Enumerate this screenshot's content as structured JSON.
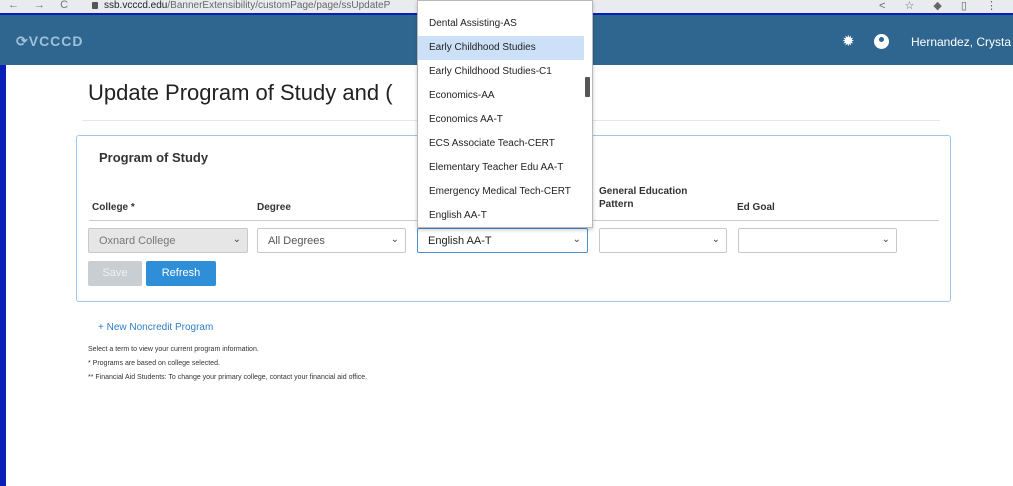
{
  "browser": {
    "nav_icons": "← → C",
    "url_host": "ssb.vcccd.edu",
    "url_path": "/BannerExtensibility/customPage/page/ssUpdateP",
    "tools": "< ☆ ◆ ▯ ⋮"
  },
  "header": {
    "logo": "VCCCD",
    "user_name": "Hernandez, Crysta"
  },
  "page": {
    "title": "Update Program of Study and",
    "title_overflow": "(",
    "card_title": "Program of Study"
  },
  "columns": {
    "college": "College *",
    "degree": "Degree",
    "ge_pattern_line1": "General Education",
    "ge_pattern_line2": "Pattern",
    "ed_goal": "Ed Goal"
  },
  "fields": {
    "college_value": "Oxnard College",
    "degree_value": "All Degrees",
    "program_value": "English AA-T",
    "ge_value": "",
    "ed_goal_value": ""
  },
  "buttons": {
    "save": "Save",
    "refresh": "Refresh"
  },
  "links": {
    "new_noncredit": "+ New Noncredit Program"
  },
  "notes": [
    "Select a term to view your current program information.",
    "* Programs are based on college selected.",
    "** Financial Aid Students: To change your primary college, contact your financial aid office."
  ],
  "dropdown": {
    "items": [
      "Dental Assisting-AS",
      "Early Childhood Studies",
      "Early Childhood Studies-C1",
      "Economics-AA",
      "Economics AA-T",
      "ECS Associate Teach-CERT",
      "Elementary Teacher Edu AA-T",
      "Emergency Medical Tech-CERT",
      "English AA-T"
    ],
    "highlighted": "Early Childhood Studies"
  }
}
